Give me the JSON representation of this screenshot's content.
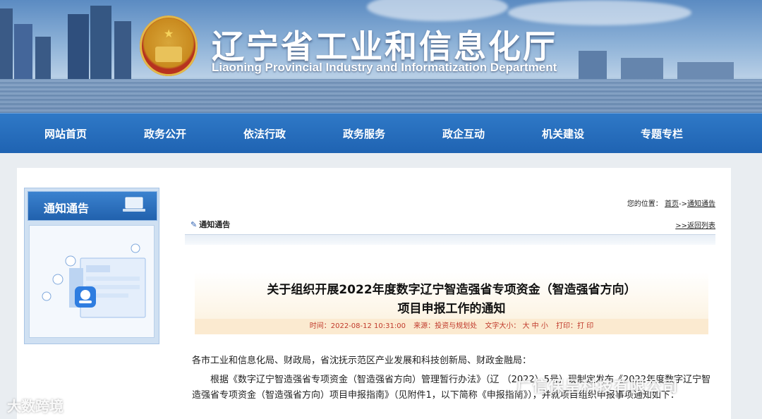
{
  "banner": {
    "title_cn": "辽宁省工业和信息化厅",
    "title_en": "Liaoning Provincial Industry and Informatization Department"
  },
  "nav": {
    "items": [
      {
        "label": "网站首页"
      },
      {
        "label": "政务公开"
      },
      {
        "label": "依法行政"
      },
      {
        "label": "政务服务"
      },
      {
        "label": "政企互动"
      },
      {
        "label": "机关建设"
      },
      {
        "label": "专题专栏"
      }
    ]
  },
  "sidebar": {
    "title": "通知通告"
  },
  "breadcrumb": {
    "prefix": "您的位置：",
    "home": "首页",
    "sep": "->",
    "current": "通知通告"
  },
  "section": {
    "title": "通知通告",
    "back_link": ">>返回列表"
  },
  "article": {
    "title_line1": "关于组织开展2022年度数字辽宁智造强省专项资金（智造强省方向）",
    "title_line2": "项目申报工作的通知",
    "time": "时间：2022-08-12 10:31:00",
    "source": "来源：投资与规划处",
    "font_size": "文字大小： 大 中 小",
    "print": "打印：打 印",
    "para1": "各市工业和信息化局、财政局，省沈抚示范区产业发展和科技创新局、财政金融局：",
    "para2": "根据《数字辽宁智造强省专项资金（智造强省方向）管理暂行办法》（辽  （2022）5号）现制定发布《2022年度数字辽宁智造强省专项资金（智造强省方向）项目申报指南》（见附件1，以下简称《申报指南》），并就项目组织申报事项通知如下："
  },
  "watermarks": {
    "left": "大数跨境",
    "right": "广信保呈科技有限公司"
  },
  "colors": {
    "nav_blue": "#1f63b2",
    "meta_red": "#c0392b",
    "meta_bg": "#fbead0"
  }
}
